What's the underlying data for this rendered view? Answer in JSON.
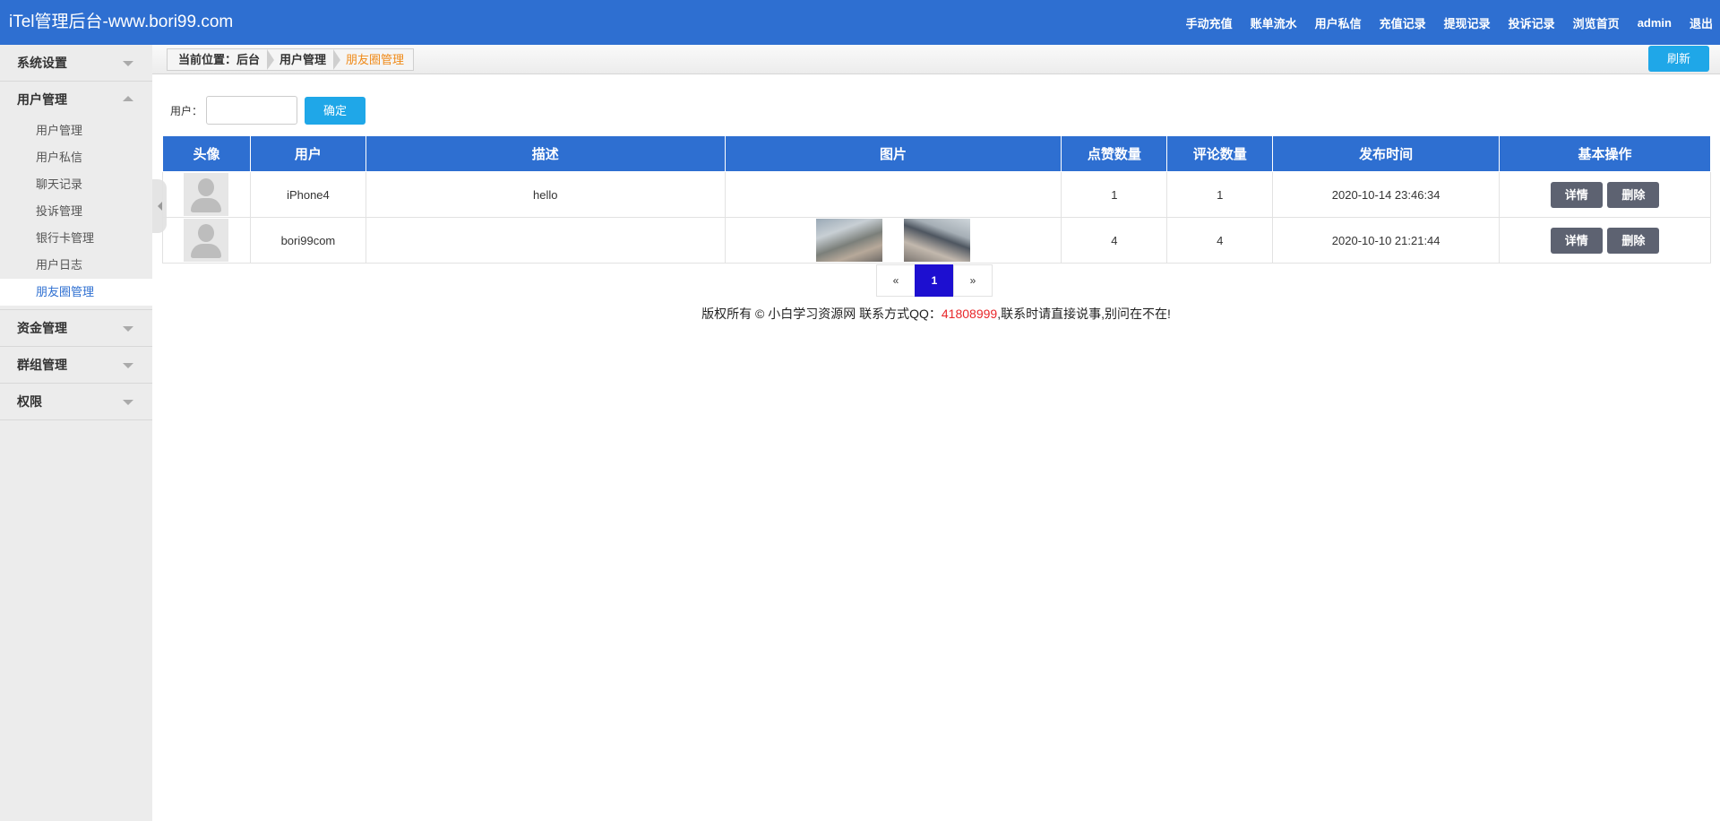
{
  "header": {
    "brand": "iTel管理后台-www.bori99.com",
    "nav": [
      "手动充值",
      "账单流水",
      "用户私信",
      "充值记录",
      "提现记录",
      "投诉记录",
      "浏览首页",
      "admin",
      "退出"
    ]
  },
  "sidebar": {
    "groups": [
      {
        "label": "系统设置"
      },
      {
        "label": "用户管理",
        "items": [
          "用户管理",
          "用户私信",
          "聊天记录",
          "投诉管理",
          "银行卡管理",
          "用户日志",
          "朋友圈管理"
        ]
      },
      {
        "label": "资金管理"
      },
      {
        "label": "群组管理"
      },
      {
        "label": "权限"
      }
    ]
  },
  "breadcrumb": {
    "items": [
      "当前位置：后台",
      "用户管理",
      "朋友圈管理"
    ]
  },
  "refresh_label": "刷新",
  "search": {
    "label": "用户：",
    "value": "",
    "placeholder": "",
    "submit": "确定"
  },
  "table": {
    "headers": [
      "头像",
      "用户",
      "描述",
      "图片",
      "点赞数量",
      "评论数量",
      "发布时间",
      "基本操作"
    ],
    "rows": [
      {
        "user": "iPhone4",
        "desc": "hello",
        "likes": "1",
        "comments": "1",
        "time": "2020-10-14 23:46:34",
        "detail": "详情",
        "delete": "删除"
      },
      {
        "user": "bori99com",
        "desc": "",
        "likes": "4",
        "comments": "4",
        "time": "2020-10-10 21:21:44",
        "detail": "详情",
        "delete": "删除"
      }
    ]
  },
  "pagination": {
    "prev": "«",
    "current": "1",
    "next": "»"
  },
  "footer": {
    "prefix": "版权所有 © 小白学习资源网 联系方式QQ：",
    "qq": "41808999",
    "suffix": ",联系时请直接说事,别问在不在!"
  },
  "colors": {
    "primary": "#2e6fd1",
    "accent": "#1fa7e8",
    "active_text": "#2e6fd1",
    "breadcrumb_current": "#f08a18",
    "qq": "#e8272a"
  }
}
